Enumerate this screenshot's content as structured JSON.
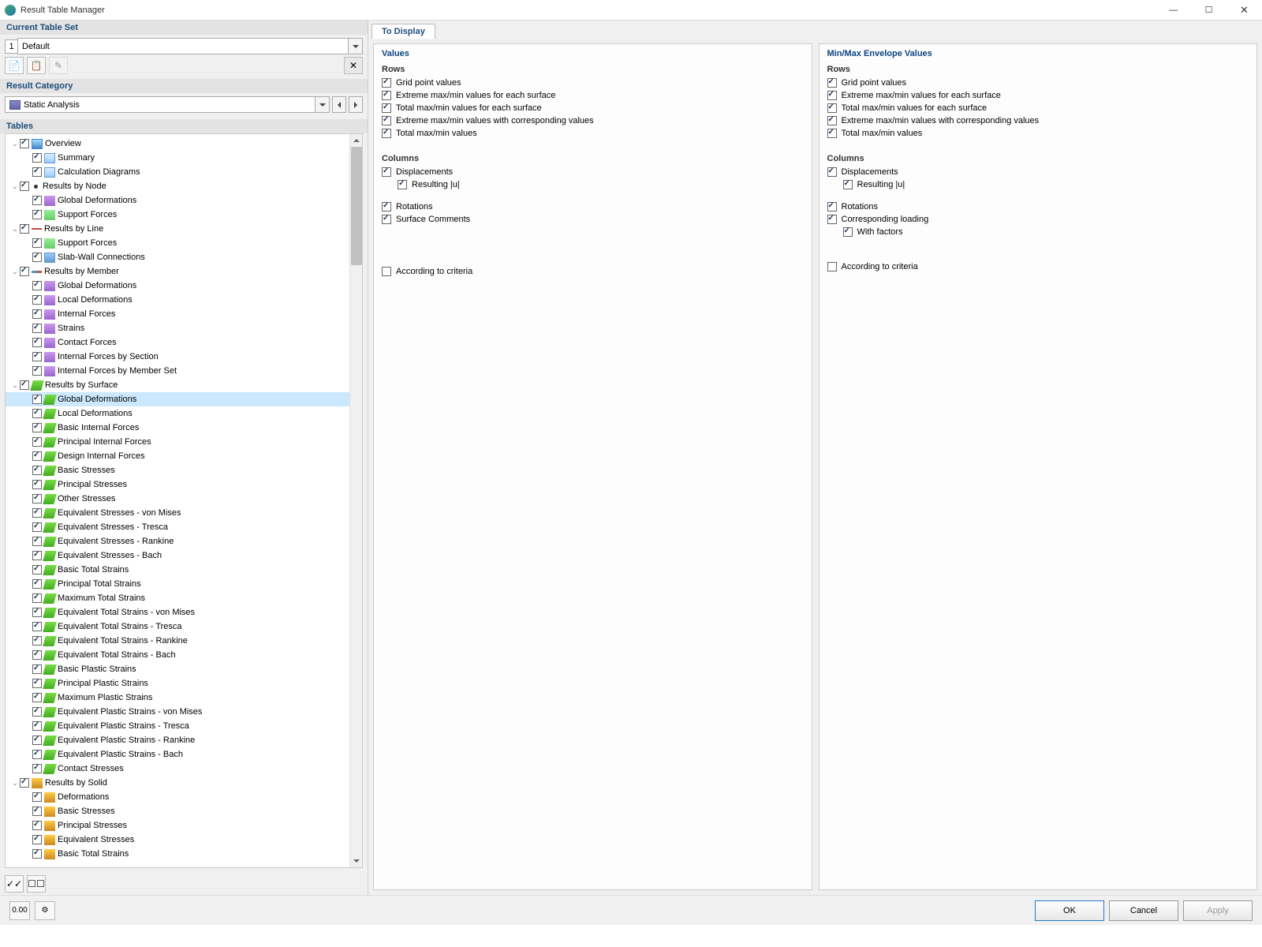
{
  "window": {
    "title": "Result Table Manager"
  },
  "current_table_set": {
    "header": "Current Table Set",
    "index": "1",
    "value": "Default"
  },
  "result_category": {
    "header": "Result Category",
    "value": "Static Analysis"
  },
  "tables_header": "Tables",
  "tree": [
    {
      "l": 0,
      "exp": "v",
      "ck": 1,
      "ic": "i-ovr",
      "label": "Overview"
    },
    {
      "l": 1,
      "exp": "",
      "ck": 1,
      "ic": "i-sum",
      "label": "Summary"
    },
    {
      "l": 1,
      "exp": "",
      "ck": 1,
      "ic": "i-sum",
      "label": "Calculation Diagrams"
    },
    {
      "l": 0,
      "exp": "v",
      "ck": 1,
      "ic": "i-node",
      "label": "Results by Node"
    },
    {
      "l": 1,
      "exp": "",
      "ck": 1,
      "ic": "i-gd",
      "label": "Global Deformations"
    },
    {
      "l": 1,
      "exp": "",
      "ck": 1,
      "ic": "i-sf",
      "label": "Support Forces"
    },
    {
      "l": 0,
      "exp": "v",
      "ck": 1,
      "ic": "i-line",
      "label": "Results by Line"
    },
    {
      "l": 1,
      "exp": "",
      "ck": 1,
      "ic": "i-sf",
      "label": "Support Forces"
    },
    {
      "l": 1,
      "exp": "",
      "ck": 1,
      "ic": "i-sw",
      "label": "Slab-Wall Connections"
    },
    {
      "l": 0,
      "exp": "v",
      "ck": 1,
      "ic": "i-mem",
      "label": "Results by Member"
    },
    {
      "l": 1,
      "exp": "",
      "ck": 1,
      "ic": "i-gd",
      "label": "Global Deformations"
    },
    {
      "l": 1,
      "exp": "",
      "ck": 1,
      "ic": "i-gd",
      "label": "Local Deformations"
    },
    {
      "l": 1,
      "exp": "",
      "ck": 1,
      "ic": "i-gd",
      "label": "Internal Forces"
    },
    {
      "l": 1,
      "exp": "",
      "ck": 1,
      "ic": "i-gd",
      "label": "Strains"
    },
    {
      "l": 1,
      "exp": "",
      "ck": 1,
      "ic": "i-gd",
      "label": "Contact Forces"
    },
    {
      "l": 1,
      "exp": "",
      "ck": 1,
      "ic": "i-gd",
      "label": "Internal Forces by Section"
    },
    {
      "l": 1,
      "exp": "",
      "ck": 1,
      "ic": "i-gd",
      "label": "Internal Forces by Member Set"
    },
    {
      "l": 0,
      "exp": "v",
      "ck": 1,
      "ic": "i-surf",
      "label": "Results by Surface"
    },
    {
      "l": 1,
      "exp": "",
      "ck": 1,
      "ic": "i-surf",
      "label": "Global Deformations",
      "sel": 1
    },
    {
      "l": 1,
      "exp": "",
      "ck": 1,
      "ic": "i-surf",
      "label": "Local Deformations"
    },
    {
      "l": 1,
      "exp": "",
      "ck": 1,
      "ic": "i-surf",
      "label": "Basic Internal Forces"
    },
    {
      "l": 1,
      "exp": "",
      "ck": 1,
      "ic": "i-surf",
      "label": "Principal Internal Forces"
    },
    {
      "l": 1,
      "exp": "",
      "ck": 1,
      "ic": "i-surf",
      "label": "Design Internal Forces"
    },
    {
      "l": 1,
      "exp": "",
      "ck": 1,
      "ic": "i-surf",
      "label": "Basic Stresses"
    },
    {
      "l": 1,
      "exp": "",
      "ck": 1,
      "ic": "i-surf",
      "label": "Principal Stresses"
    },
    {
      "l": 1,
      "exp": "",
      "ck": 1,
      "ic": "i-surf",
      "label": "Other Stresses"
    },
    {
      "l": 1,
      "exp": "",
      "ck": 1,
      "ic": "i-surf",
      "label": "Equivalent Stresses - von Mises"
    },
    {
      "l": 1,
      "exp": "",
      "ck": 1,
      "ic": "i-surf",
      "label": "Equivalent Stresses - Tresca"
    },
    {
      "l": 1,
      "exp": "",
      "ck": 1,
      "ic": "i-surf",
      "label": "Equivalent Stresses - Rankine"
    },
    {
      "l": 1,
      "exp": "",
      "ck": 1,
      "ic": "i-surf",
      "label": "Equivalent Stresses - Bach"
    },
    {
      "l": 1,
      "exp": "",
      "ck": 1,
      "ic": "i-surf",
      "label": "Basic Total Strains"
    },
    {
      "l": 1,
      "exp": "",
      "ck": 1,
      "ic": "i-surf",
      "label": "Principal Total Strains"
    },
    {
      "l": 1,
      "exp": "",
      "ck": 1,
      "ic": "i-surf",
      "label": "Maximum Total Strains"
    },
    {
      "l": 1,
      "exp": "",
      "ck": 1,
      "ic": "i-surf",
      "label": "Equivalent Total Strains - von Mises"
    },
    {
      "l": 1,
      "exp": "",
      "ck": 1,
      "ic": "i-surf",
      "label": "Equivalent Total Strains - Tresca"
    },
    {
      "l": 1,
      "exp": "",
      "ck": 1,
      "ic": "i-surf",
      "label": "Equivalent Total Strains - Rankine"
    },
    {
      "l": 1,
      "exp": "",
      "ck": 1,
      "ic": "i-surf",
      "label": "Equivalent Total Strains - Bach"
    },
    {
      "l": 1,
      "exp": "",
      "ck": 1,
      "ic": "i-surf",
      "label": "Basic Plastic Strains"
    },
    {
      "l": 1,
      "exp": "",
      "ck": 1,
      "ic": "i-surf",
      "label": "Principal Plastic Strains"
    },
    {
      "l": 1,
      "exp": "",
      "ck": 1,
      "ic": "i-surf",
      "label": "Maximum Plastic Strains"
    },
    {
      "l": 1,
      "exp": "",
      "ck": 1,
      "ic": "i-surf",
      "label": "Equivalent Plastic Strains - von Mises"
    },
    {
      "l": 1,
      "exp": "",
      "ck": 1,
      "ic": "i-surf",
      "label": "Equivalent Plastic Strains - Tresca"
    },
    {
      "l": 1,
      "exp": "",
      "ck": 1,
      "ic": "i-surf",
      "label": "Equivalent Plastic Strains - Rankine"
    },
    {
      "l": 1,
      "exp": "",
      "ck": 1,
      "ic": "i-surf",
      "label": "Equivalent Plastic Strains - Bach"
    },
    {
      "l": 1,
      "exp": "",
      "ck": 1,
      "ic": "i-surf",
      "label": "Contact Stresses"
    },
    {
      "l": 0,
      "exp": "v",
      "ck": 1,
      "ic": "i-solid",
      "label": "Results by Solid"
    },
    {
      "l": 1,
      "exp": "",
      "ck": 1,
      "ic": "i-solid",
      "label": "Deformations"
    },
    {
      "l": 1,
      "exp": "",
      "ck": 1,
      "ic": "i-solid",
      "label": "Basic Stresses"
    },
    {
      "l": 1,
      "exp": "",
      "ck": 1,
      "ic": "i-solid",
      "label": "Principal Stresses"
    },
    {
      "l": 1,
      "exp": "",
      "ck": 1,
      "ic": "i-solid",
      "label": "Equivalent Stresses"
    },
    {
      "l": 1,
      "exp": "",
      "ck": 1,
      "ic": "i-solid",
      "label": "Basic Total Strains"
    }
  ],
  "tab": "To Display",
  "values": {
    "title": "Values",
    "rows_hdr": "Rows",
    "rows": [
      {
        "ck": 1,
        "label": "Grid point values"
      },
      {
        "ck": 1,
        "label": "Extreme max/min values for each surface"
      },
      {
        "ck": 1,
        "label": "Total max/min values for each surface"
      },
      {
        "ck": 1,
        "label": "Extreme max/min values with corresponding values"
      },
      {
        "ck": 1,
        "label": "Total max/min values"
      }
    ],
    "cols_hdr": "Columns",
    "cols": [
      {
        "ck": 1,
        "label": "Displacements",
        "in": 0
      },
      {
        "ck": 1,
        "label": "Resulting |u|",
        "in": 1
      },
      {
        "sp": 1
      },
      {
        "ck": 1,
        "label": "Rotations",
        "in": 0
      },
      {
        "ck": 1,
        "label": "Surface Comments",
        "in": 0
      }
    ],
    "criteria": {
      "ck": 0,
      "label": "According to criteria"
    }
  },
  "envelope": {
    "title": "Min/Max Envelope Values",
    "rows_hdr": "Rows",
    "rows": [
      {
        "ck": 1,
        "label": "Grid point values"
      },
      {
        "ck": 1,
        "label": "Extreme max/min values for each surface"
      },
      {
        "ck": 1,
        "label": "Total max/min values for each surface"
      },
      {
        "ck": 1,
        "label": "Extreme max/min values with corresponding values"
      },
      {
        "ck": 1,
        "label": "Total max/min values"
      }
    ],
    "cols_hdr": "Columns",
    "cols": [
      {
        "ck": 1,
        "label": "Displacements",
        "in": 0
      },
      {
        "ck": 1,
        "label": "Resulting |u|",
        "in": 1
      },
      {
        "sp": 1
      },
      {
        "ck": 1,
        "label": "Rotations",
        "in": 0
      },
      {
        "ck": 1,
        "label": "Corresponding loading",
        "in": 0
      },
      {
        "ck": 1,
        "label": "With factors",
        "in": 1
      }
    ],
    "criteria": {
      "ck": 0,
      "label": "According to criteria"
    }
  },
  "footer": {
    "ok": "OK",
    "cancel": "Cancel",
    "apply": "Apply"
  }
}
